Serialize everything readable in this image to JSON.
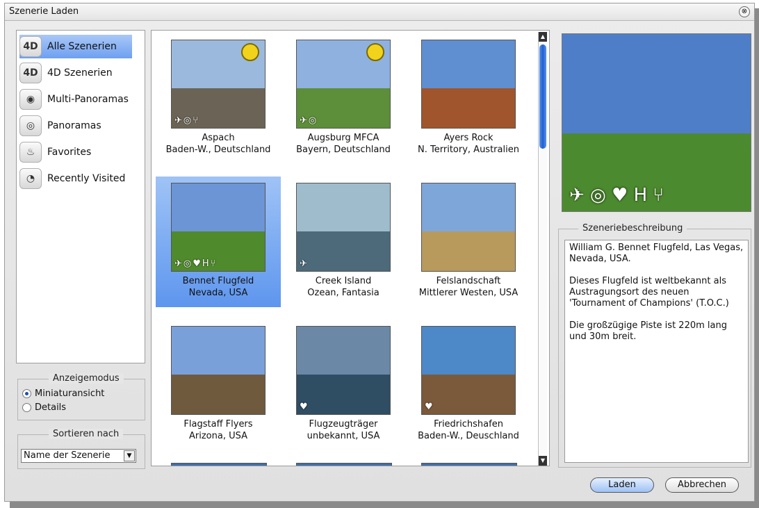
{
  "window": {
    "title": "Szenerie Laden",
    "close_glyph": "⊗"
  },
  "categories": [
    {
      "label": "Alle Szenerien",
      "icon": "all-scenes-icon",
      "glyph": "4D",
      "selected": true
    },
    {
      "label": "4D Szenerien",
      "icon": "4d-icon",
      "glyph": "4D",
      "selected": false
    },
    {
      "label": "Multi-Panoramas",
      "icon": "eye-icon",
      "glyph": "◉",
      "selected": false
    },
    {
      "label": "Panoramas",
      "icon": "camera-icon",
      "glyph": "◎",
      "selected": false
    },
    {
      "label": "Favorites",
      "icon": "flame-icon",
      "glyph": "♨",
      "selected": false
    },
    {
      "label": "Recently Visited",
      "icon": "clock-icon",
      "glyph": "◔",
      "selected": false
    }
  ],
  "display_mode": {
    "legend": "Anzeigemodus",
    "options": [
      {
        "label": "Miniaturansicht",
        "checked": true
      },
      {
        "label": "Details",
        "checked": false
      }
    ]
  },
  "sort": {
    "legend": "Sortieren nach",
    "value": "Name der Szenerie",
    "arrow": "▼"
  },
  "scenes": [
    {
      "name": "Aspach",
      "location": "Baden-W., Deutschland",
      "sky": "#9bb9dc",
      "ground": "#6b6456",
      "marks": "✈◎⑂",
      "badge": true,
      "selected": false
    },
    {
      "name": "Augsburg MFCA",
      "location": "Bayern, Deutschland",
      "sky": "#8fb1e0",
      "ground": "#5d8e3a",
      "marks": "✈◎",
      "badge": true,
      "selected": false
    },
    {
      "name": "Ayers Rock",
      "location": "N. Territory, Australien",
      "sky": "#5f8fd1",
      "ground": "#a0552c",
      "marks": "",
      "badge": false,
      "selected": false
    },
    {
      "name": "Bennet Flugfeld",
      "location": "Nevada, USA",
      "sky": "#6c95d6",
      "ground": "#4f8a2c",
      "marks": "✈◎♥H⑂",
      "badge": false,
      "selected": true
    },
    {
      "name": "Creek Island",
      "location": "Ozean, Fantasia",
      "sky": "#9fbccc",
      "ground": "#4d6a7a",
      "marks": "✈",
      "badge": false,
      "selected": false
    },
    {
      "name": "Felslandschaft",
      "location": "Mittlerer Westen, USA",
      "sky": "#7fa6d9",
      "ground": "#b89a5c",
      "marks": "",
      "badge": false,
      "selected": false
    },
    {
      "name": "Flagstaff Flyers",
      "location": "Arizona, USA",
      "sky": "#7aa0da",
      "ground": "#6f5a3e",
      "marks": "",
      "badge": false,
      "selected": false
    },
    {
      "name": "Flugzeugträger",
      "location": "unbekannt, USA",
      "sky": "#6b89a6",
      "ground": "#2f4d63",
      "marks": "♥",
      "badge": false,
      "selected": false
    },
    {
      "name": "Friedrichshafen",
      "location": "Baden-W., Deuschland",
      "sky": "#4d88c8",
      "ground": "#7a5a3a",
      "marks": "♥",
      "badge": false,
      "selected": false
    }
  ],
  "preview": {
    "sky": "#4f7ec9",
    "ground": "#4c8a2f",
    "marks": "✈ ◎ ♥ H ⑂"
  },
  "description": {
    "legend": "Szeneriebeschreibung",
    "paragraphs": [
      "William G. Bennet Flugfeld, Las Vegas, Nevada, USA.",
      "Dieses Flugfeld ist weltbekannt als Austragungsort des neuen 'Tournament of Champions' (T.O.C.)",
      "Die großzügige Piste ist 220m lang und 30m breit."
    ]
  },
  "buttons": {
    "load": "Laden",
    "cancel": "Abbrechen"
  },
  "scrollbar": {
    "up": "▲",
    "down": "▼"
  }
}
